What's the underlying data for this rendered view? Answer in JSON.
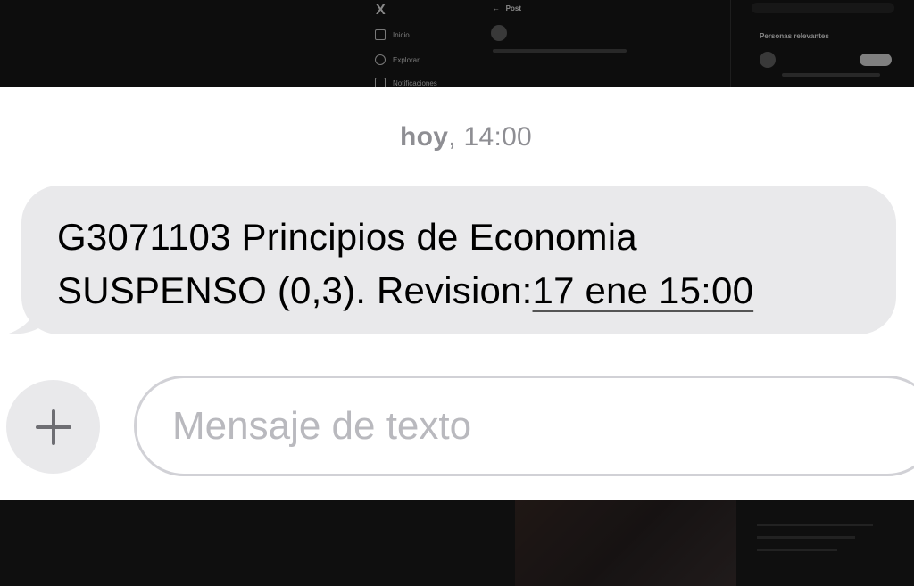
{
  "background_app": {
    "logo": "X",
    "header_title": "Post",
    "nav_items": [
      "Inicio",
      "Explorar",
      "Notificaciones"
    ],
    "right_panel_title": "Personas relevantes"
  },
  "conversation": {
    "timestamp_day": "hoy",
    "timestamp_time": ", 14:00",
    "message": {
      "line1": "G3071103 Principios de Economia",
      "line2_prefix": "SUSPENSO (0,3). Revision:",
      "line2_date": "17 ene 15:00"
    }
  },
  "composer": {
    "plus_icon": "plus-icon",
    "placeholder": "Mensaje de texto",
    "value": ""
  },
  "colors": {
    "bubble_gray": "#e9e9eb",
    "timestamp_gray": "#8e8e93",
    "placeholder_gray": "#b9b9be",
    "field_border": "#d1d1d6"
  }
}
